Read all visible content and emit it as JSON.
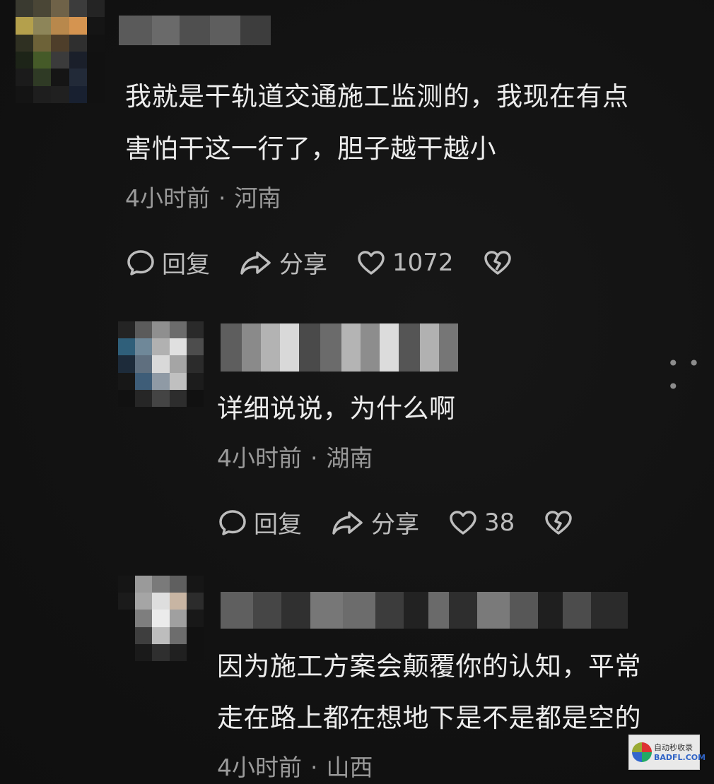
{
  "comments": [
    {
      "lines": [
        "我就是干轨道交通施工监测的，我现在有点",
        "害怕干这一行了，胆子越干越小"
      ],
      "time": "4小时前",
      "location": "河南",
      "actions": {
        "reply": "回复",
        "share": "分享",
        "likes": "1072"
      }
    },
    {
      "lines": [
        "详细说说，为什么啊"
      ],
      "time": "4小时前",
      "location": "湖南",
      "actions": {
        "reply": "回复",
        "share": "分享",
        "likes": "38"
      }
    },
    {
      "lines": [
        "因为施工方案会颠覆你的认知，平常",
        "走在路上都在想地下是不是都是空的"
      ],
      "time": "4小时前",
      "location": "山西"
    }
  ],
  "separator": "·",
  "more_menu": "• • •",
  "watermark": {
    "title": "自动秒收录",
    "url": "BADFL.COM"
  },
  "icons": [
    "comment-icon",
    "share-icon",
    "heart-icon",
    "broken-heart-icon",
    "more-icon"
  ]
}
